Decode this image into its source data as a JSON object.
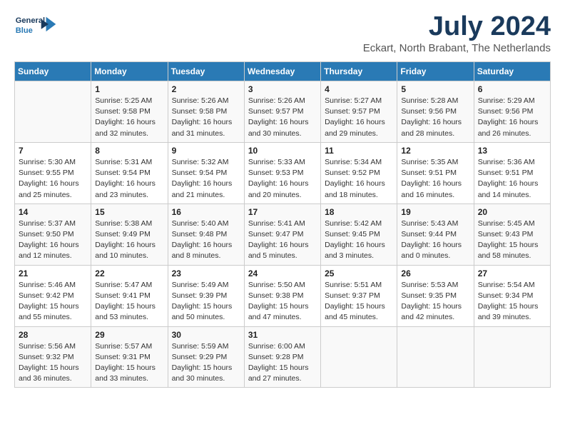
{
  "header": {
    "logo_line1": "General",
    "logo_line2": "Blue",
    "main_title": "July 2024",
    "subtitle": "Eckart, North Brabant, The Netherlands"
  },
  "calendar": {
    "days_of_week": [
      "Sunday",
      "Monday",
      "Tuesday",
      "Wednesday",
      "Thursday",
      "Friday",
      "Saturday"
    ],
    "weeks": [
      [
        {
          "day": "",
          "info": ""
        },
        {
          "day": "1",
          "info": "Sunrise: 5:25 AM\nSunset: 9:58 PM\nDaylight: 16 hours\nand 32 minutes."
        },
        {
          "day": "2",
          "info": "Sunrise: 5:26 AM\nSunset: 9:58 PM\nDaylight: 16 hours\nand 31 minutes."
        },
        {
          "day": "3",
          "info": "Sunrise: 5:26 AM\nSunset: 9:57 PM\nDaylight: 16 hours\nand 30 minutes."
        },
        {
          "day": "4",
          "info": "Sunrise: 5:27 AM\nSunset: 9:57 PM\nDaylight: 16 hours\nand 29 minutes."
        },
        {
          "day": "5",
          "info": "Sunrise: 5:28 AM\nSunset: 9:56 PM\nDaylight: 16 hours\nand 28 minutes."
        },
        {
          "day": "6",
          "info": "Sunrise: 5:29 AM\nSunset: 9:56 PM\nDaylight: 16 hours\nand 26 minutes."
        }
      ],
      [
        {
          "day": "7",
          "info": "Sunrise: 5:30 AM\nSunset: 9:55 PM\nDaylight: 16 hours\nand 25 minutes."
        },
        {
          "day": "8",
          "info": "Sunrise: 5:31 AM\nSunset: 9:54 PM\nDaylight: 16 hours\nand 23 minutes."
        },
        {
          "day": "9",
          "info": "Sunrise: 5:32 AM\nSunset: 9:54 PM\nDaylight: 16 hours\nand 21 minutes."
        },
        {
          "day": "10",
          "info": "Sunrise: 5:33 AM\nSunset: 9:53 PM\nDaylight: 16 hours\nand 20 minutes."
        },
        {
          "day": "11",
          "info": "Sunrise: 5:34 AM\nSunset: 9:52 PM\nDaylight: 16 hours\nand 18 minutes."
        },
        {
          "day": "12",
          "info": "Sunrise: 5:35 AM\nSunset: 9:51 PM\nDaylight: 16 hours\nand 16 minutes."
        },
        {
          "day": "13",
          "info": "Sunrise: 5:36 AM\nSunset: 9:51 PM\nDaylight: 16 hours\nand 14 minutes."
        }
      ],
      [
        {
          "day": "14",
          "info": "Sunrise: 5:37 AM\nSunset: 9:50 PM\nDaylight: 16 hours\nand 12 minutes."
        },
        {
          "day": "15",
          "info": "Sunrise: 5:38 AM\nSunset: 9:49 PM\nDaylight: 16 hours\nand 10 minutes."
        },
        {
          "day": "16",
          "info": "Sunrise: 5:40 AM\nSunset: 9:48 PM\nDaylight: 16 hours\nand 8 minutes."
        },
        {
          "day": "17",
          "info": "Sunrise: 5:41 AM\nSunset: 9:47 PM\nDaylight: 16 hours\nand 5 minutes."
        },
        {
          "day": "18",
          "info": "Sunrise: 5:42 AM\nSunset: 9:45 PM\nDaylight: 16 hours\nand 3 minutes."
        },
        {
          "day": "19",
          "info": "Sunrise: 5:43 AM\nSunset: 9:44 PM\nDaylight: 16 hours\nand 0 minutes."
        },
        {
          "day": "20",
          "info": "Sunrise: 5:45 AM\nSunset: 9:43 PM\nDaylight: 15 hours\nand 58 minutes."
        }
      ],
      [
        {
          "day": "21",
          "info": "Sunrise: 5:46 AM\nSunset: 9:42 PM\nDaylight: 15 hours\nand 55 minutes."
        },
        {
          "day": "22",
          "info": "Sunrise: 5:47 AM\nSunset: 9:41 PM\nDaylight: 15 hours\nand 53 minutes."
        },
        {
          "day": "23",
          "info": "Sunrise: 5:49 AM\nSunset: 9:39 PM\nDaylight: 15 hours\nand 50 minutes."
        },
        {
          "day": "24",
          "info": "Sunrise: 5:50 AM\nSunset: 9:38 PM\nDaylight: 15 hours\nand 47 minutes."
        },
        {
          "day": "25",
          "info": "Sunrise: 5:51 AM\nSunset: 9:37 PM\nDaylight: 15 hours\nand 45 minutes."
        },
        {
          "day": "26",
          "info": "Sunrise: 5:53 AM\nSunset: 9:35 PM\nDaylight: 15 hours\nand 42 minutes."
        },
        {
          "day": "27",
          "info": "Sunrise: 5:54 AM\nSunset: 9:34 PM\nDaylight: 15 hours\nand 39 minutes."
        }
      ],
      [
        {
          "day": "28",
          "info": "Sunrise: 5:56 AM\nSunset: 9:32 PM\nDaylight: 15 hours\nand 36 minutes."
        },
        {
          "day": "29",
          "info": "Sunrise: 5:57 AM\nSunset: 9:31 PM\nDaylight: 15 hours\nand 33 minutes."
        },
        {
          "day": "30",
          "info": "Sunrise: 5:59 AM\nSunset: 9:29 PM\nDaylight: 15 hours\nand 30 minutes."
        },
        {
          "day": "31",
          "info": "Sunrise: 6:00 AM\nSunset: 9:28 PM\nDaylight: 15 hours\nand 27 minutes."
        },
        {
          "day": "",
          "info": ""
        },
        {
          "day": "",
          "info": ""
        },
        {
          "day": "",
          "info": ""
        }
      ]
    ]
  }
}
